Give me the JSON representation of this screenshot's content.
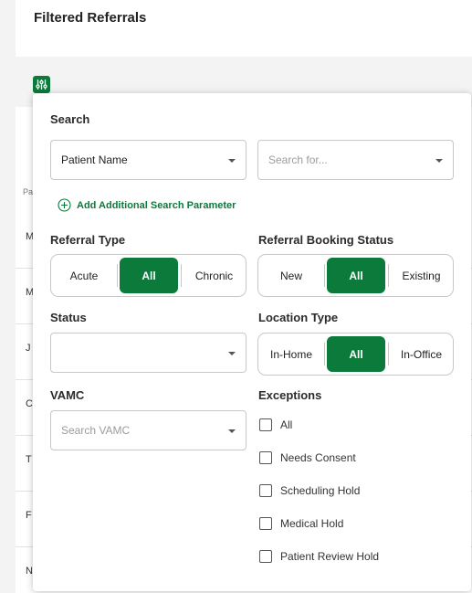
{
  "page": {
    "title": "Filtered Referrals"
  },
  "background_table": {
    "column_header": "Pa",
    "row_initials": [
      "M",
      "M",
      "J",
      "C",
      "T",
      "F",
      "N"
    ]
  },
  "filters": {
    "search": {
      "label": "Search",
      "field_select": "Patient Name",
      "query_placeholder": "Search for...",
      "add_parameter_label": "Add Additional Search Parameter"
    },
    "referral_type": {
      "label": "Referral Type",
      "options": [
        "Acute",
        "All",
        "Chronic"
      ],
      "selected": "All"
    },
    "referral_booking_status": {
      "label": "Referral Booking Status",
      "options": [
        "New",
        "All",
        "Existing"
      ],
      "selected": "All"
    },
    "status": {
      "label": "Status",
      "value": ""
    },
    "location_type": {
      "label": "Location Type",
      "options": [
        "In-Home",
        "All",
        "In-Office"
      ],
      "selected": "All"
    },
    "vamc": {
      "label": "VAMC",
      "placeholder": "Search VAMC"
    },
    "exceptions": {
      "label": "Exceptions",
      "options": [
        "All",
        "Needs Consent",
        "Scheduling Hold",
        "Medical Hold",
        "Patient Review Hold"
      ],
      "checked": []
    }
  },
  "colors": {
    "accent": "#0b7a3b",
    "border": "#c8c8c8"
  }
}
